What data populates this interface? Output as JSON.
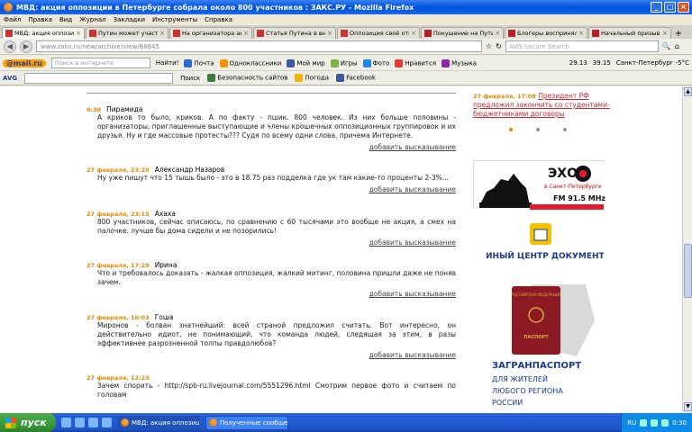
{
  "window": {
    "title": "МВД: акция оппозиции в Петербурге собрала около 800 участников : ЗАКС.РУ - Mozilla Firefox",
    "controls": [
      "_",
      "□",
      "×"
    ]
  },
  "menu": [
    "Файл",
    "Правка",
    "Вид",
    "Журнал",
    "Закладки",
    "Инструменты",
    "Справка"
  ],
  "tabs": [
    {
      "label": "МВД: акция оппози...",
      "active": true,
      "favicon": "zaks"
    },
    {
      "label": "Путин может участ...",
      "active": false,
      "favicon": "zaks"
    },
    {
      "label": "На организатора ак...",
      "active": false,
      "favicon": "zaks"
    },
    {
      "label": "Статья Путина в вн...",
      "active": false,
      "favicon": "zaks"
    },
    {
      "label": "Оппозиция своё отк...",
      "active": false,
      "favicon": "zaks"
    },
    {
      "label": "Покушение на Пути...",
      "active": false,
      "favicon": "dp"
    },
    {
      "label": "Блогеры воспринял...",
      "active": false,
      "favicon": "dp"
    },
    {
      "label": "Начальный призыв...",
      "active": false,
      "favicon": "dp"
    }
  ],
  "nav": {
    "url": "www.zaks.ru/new/archive/view/88845",
    "search_placeholder": "AVG Secure Search"
  },
  "toolbar1": {
    "logo": "@mail.ru",
    "search_placeholder": "Поиск в интернете",
    "find_label": "Найти!",
    "items": [
      "Почта",
      "Одноклассники",
      "Мой мир",
      "Игры",
      "Фото",
      "Нравится",
      "Музыка"
    ],
    "weather": [
      "29.13",
      "39.15",
      "Санкт-Петербург -5°C"
    ]
  },
  "toolbar2": {
    "logo": "AVG",
    "search_label": "Поиск",
    "items": [
      "Безопасность сайтов",
      "Погода",
      "Facebook"
    ]
  },
  "comments": [
    {
      "date": "6:30",
      "author": "Пирамида",
      "text": "А криков то было, криков. А по факту - пшик. 800 человек. Из них больше половины - организаторы, приглашенные выступающие и члены крошечных оппозиционных группировок и их друзья. Ну и где массовые протесты??? Судя по всему одни слова, причема Интернете.",
      "add": "добавить высказывание"
    },
    {
      "date": "27 февраля, 23:20",
      "author": "Александр Назаров",
      "text": "Ну уже пишут что 15 тышь было - это в 18.75 раз подделка где ук там какие-то проценты 2-3%...",
      "add": "добавить высказывание"
    },
    {
      "date": "27 февраля, 23:15",
      "author": "Ахаха",
      "text": "800 участников, сейчас описаюсь, по сравнению с 60 тысячами это вообще не акция, а смех на палочке. лучше бы дома сидели и не позорились!",
      "add": "добавить высказывание"
    },
    {
      "date": "27 февраля, 17:29",
      "author": "Ирина",
      "text": "Что и требовалось доказать - жалкая оппозиция, жалкий митинг, половина пришли даже не поняв зачем.",
      "add": "добавить высказывание"
    },
    {
      "date": "27 февраля, 16:03",
      "author": "Гоша",
      "text": "Миронов - болван знатнейший: всей страной предложил считать. Вот интересно, он действительно идиот, не понимающий, что команда людей, следящая за этим, в разы эффективнее разрозненной толпы правдолюбов?",
      "add": "добавить высказывание"
    },
    {
      "date": "27 февраля, 12:23",
      "author": "",
      "text": "Зачем спорить - http://spb-ru.livejournal.com/5551296.html Смотрим первое фото и считаем по головам",
      "add": ""
    }
  ],
  "sidebar": {
    "news_date": "27 февраля, 17:08",
    "news_text": "Президент РФ предложил закончить со студентами-бюджетниками договоры",
    "echo_logo": "ЭХО",
    "echo_city": "в Санкт-Петербурге",
    "echo_fm": "FM 91.5 MHz",
    "doc_title": "ЕДИНЫЙ ЦЕНТР ДОКУМЕНТОВ",
    "passport_label": "ПАСПОРТ",
    "passport_country": "РОССИЙСКАЯ ФЕДЕРАЦИЯ",
    "doc_line1": "ЗАГРАНПАСПОРТ",
    "doc_line2": "ДЛЯ ЖИТЕЛЕЙ",
    "doc_line3": "ЛЮБОГО РЕГИОНА",
    "doc_line4": "РОССИИ"
  },
  "taskbar": {
    "start": "пуск",
    "tasks": [
      "МВД: акция оппозиц...",
      "Полученные сообще..."
    ],
    "lang": "RU",
    "time": "0:30"
  }
}
